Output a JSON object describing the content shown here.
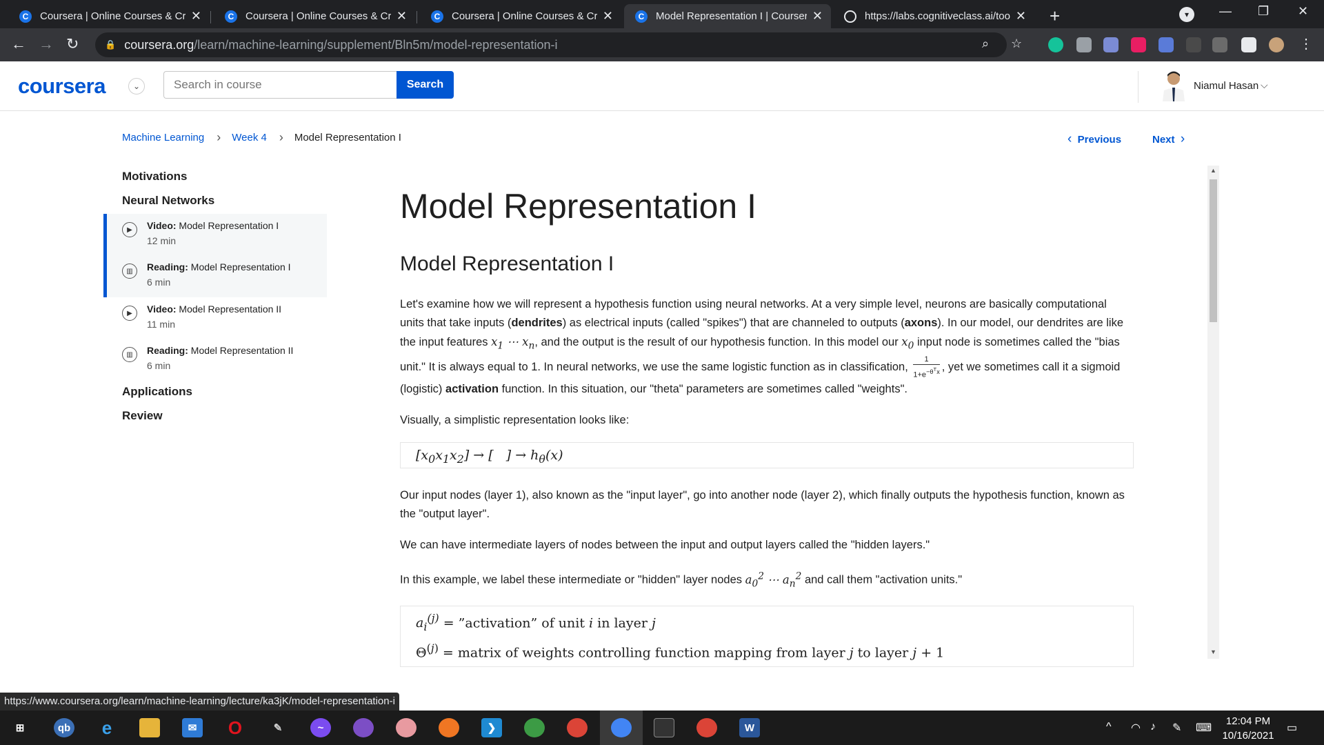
{
  "browser": {
    "tabs": [
      {
        "title": "Coursera | Online Courses & Credentials",
        "active": false
      },
      {
        "title": "Coursera | Online Courses & Credentials",
        "active": false
      },
      {
        "title": "Coursera | Online Courses & Credentials",
        "active": false
      },
      {
        "title": "Model Representation I | Coursera",
        "active": true
      },
      {
        "title": "https://labs.cognitiveclass.ai/tools",
        "active": false
      }
    ],
    "url_host": "coursera.org",
    "url_path": "/learn/machine-learning/supplement/Bln5m/model-representation-i",
    "status_url": "https://www.coursera.org/learn/machine-learning/lecture/ka3jK/model-representation-i"
  },
  "header": {
    "logo": "coursera",
    "search_placeholder": "Search in course",
    "search_button": "Search",
    "user_name": "Niamul Hasan"
  },
  "breadcrumb": {
    "course": "Machine Learning",
    "week": "Week 4",
    "current": "Model Representation I"
  },
  "nav": {
    "previous": "Previous",
    "next": "Next"
  },
  "sidebar": {
    "sections": [
      "Motivations",
      "Neural Networks",
      "Applications",
      "Review"
    ],
    "items": [
      {
        "type": "Video:",
        "title": "Model Representation I",
        "duration": "12 min",
        "icon": "play-icon"
      },
      {
        "type": "Reading:",
        "title": "Model Representation I",
        "duration": "6 min",
        "icon": "book-icon"
      },
      {
        "type": "Video:",
        "title": "Model Representation II",
        "duration": "11 min",
        "icon": "play-icon"
      },
      {
        "type": "Reading:",
        "title": "Model Representation II",
        "duration": "6 min",
        "icon": "book-icon"
      }
    ]
  },
  "article": {
    "title": "Model Representation I",
    "subtitle": "Model Representation I",
    "p1_a": "Let's examine how we will represent a hypothesis function using neural networks. At a very simple level, neurons are basically computational units that take inputs (",
    "p1_b": "dendrites",
    "p1_c": ") as electrical inputs (called \"spikes\") that are channeled to outputs (",
    "p1_d": "axons",
    "p1_e": "). In our model, our dendrites are like the input features ",
    "p1_f": ", and the output is the result of our hypothesis function. In this model our ",
    "p1_g": " input node is sometimes called the \"bias unit.\" It is always equal to 1. In neural networks, we use the same logistic function as in classification, ",
    "p1_h": ", yet we sometimes call it a sigmoid (logistic) ",
    "p1_i": "activation",
    "p1_j": " function. In this situation, our \"theta\" parameters are sometimes called \"weights\".",
    "p2": "Visually, a simplistic representation looks like:",
    "math1": "[x₀x₁x₂] → [   ] → h_θ(x)",
    "p3": "Our input nodes (layer 1), also known as the \"input layer\", go into another node (layer 2), which finally outputs the hypothesis function, known as the \"output layer\".",
    "p4": "We can have intermediate layers of nodes between the input and output layers called the \"hidden layers.\"",
    "p5_a": "In this example, we label these intermediate or \"hidden\" layer nodes ",
    "p5_b": " and call them \"activation units.\"",
    "math2_line1": "a_i^(j) = \"activation\" of unit i in layer j",
    "math2_line2": "Θ^(j) = matrix of weights controlling function mapping from layer j to layer j+1"
  },
  "taskbar": {
    "time": "12:04 PM",
    "date": "10/16/2021"
  }
}
